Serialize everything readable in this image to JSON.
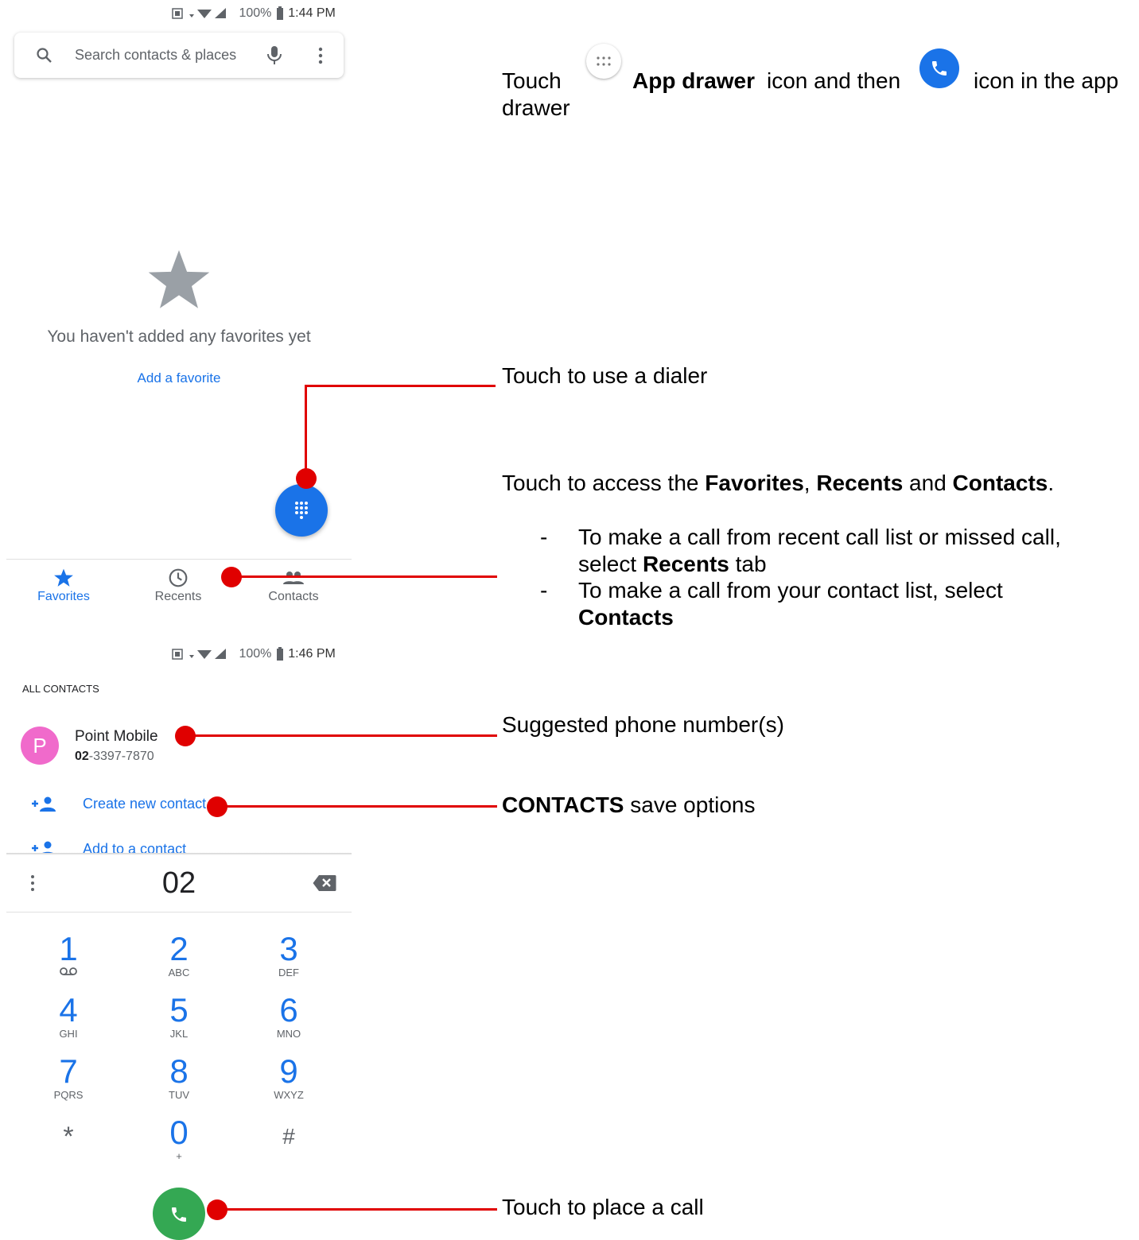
{
  "screen1": {
    "status_battery": "100%",
    "status_time": "1:44 PM",
    "search_placeholder": "Search contacts & places",
    "empty_message": "You haven't added any favorites yet",
    "add_favorite": "Add a favorite",
    "tabs": [
      {
        "label": "Favorites",
        "icon": "star-icon"
      },
      {
        "label": "Recents",
        "icon": "clock-icon"
      },
      {
        "label": "Contacts",
        "icon": "people-icon"
      }
    ]
  },
  "screen2": {
    "status_battery": "100%",
    "status_time": "1:46 PM",
    "section_header": "ALL CONTACTS",
    "contact": {
      "initial": "P",
      "name": "Point Mobile",
      "number_bold": "02",
      "number_rest": "-3397-7870"
    },
    "create_contact": "Create new contact",
    "add_to_contact": "Add to a contact",
    "dialed_number": "02",
    "keys": [
      {
        "digit": "1",
        "letters": "voicemail-icon"
      },
      {
        "digit": "2",
        "letters": "ABC"
      },
      {
        "digit": "3",
        "letters": "DEF"
      },
      {
        "digit": "4",
        "letters": "GHI"
      },
      {
        "digit": "5",
        "letters": "JKL"
      },
      {
        "digit": "6",
        "letters": "MNO"
      },
      {
        "digit": "7",
        "letters": "PQRS"
      },
      {
        "digit": "8",
        "letters": "TUV"
      },
      {
        "digit": "9",
        "letters": "WXYZ"
      },
      {
        "digit": "*",
        "letters": ""
      },
      {
        "digit": "0",
        "letters": "+"
      },
      {
        "digit": "#",
        "letters": ""
      }
    ]
  },
  "instructions": {
    "top_touch": "Touch",
    "top_app_drawer": "App drawer",
    "top_mid": "icon and then",
    "top_end": "icon in the app",
    "top_line2": "drawer",
    "dialer": "Touch to use a dialer",
    "access_pre": "Touch to access the",
    "access_favorites": "Favorites",
    "access_comma": ",",
    "access_recents": "Recents",
    "access_and": "and",
    "access_contacts": "Contacts",
    "access_period": ".",
    "bullet1_a": "To make a call from recent call list or missed call,",
    "bullet1_b_pre": "select",
    "bullet1_b_bold": "Recents",
    "bullet1_b_post": "tab",
    "bullet2_a": "To make a call from your contact list, select",
    "bullet2_b_bold": "Contacts",
    "bullet_dash": "-",
    "suggested": "Suggested phone number(s)",
    "contacts_bold": "CONTACTS",
    "contacts_rest": "save options",
    "place_call": "Touch to place a call"
  },
  "colors": {
    "accent": "#1a73e8",
    "call_green": "#34a853",
    "annotation_red": "#e00000",
    "avatar_pink": "#f06acb"
  }
}
